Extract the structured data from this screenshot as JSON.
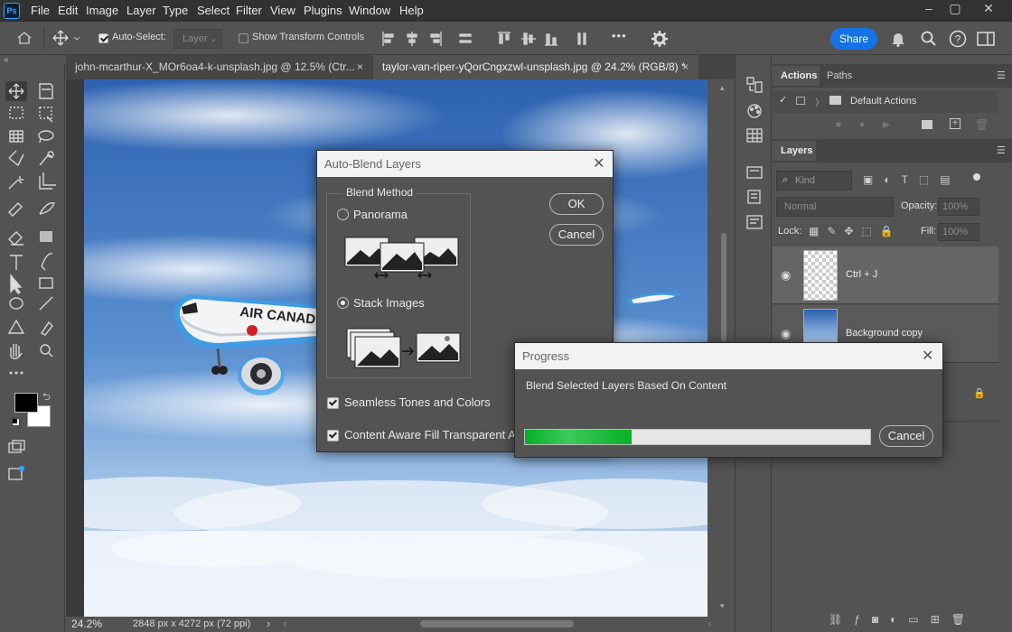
{
  "app": {
    "logo": "Ps"
  },
  "menu": [
    "File",
    "Edit",
    "Image",
    "Layer",
    "Type",
    "Select",
    "Filter",
    "View",
    "Plugins",
    "Window",
    "Help"
  ],
  "options": {
    "auto_select_label": "Auto-Select:",
    "auto_select_target": "Layer",
    "show_transform_label": "Show Transform Controls",
    "share_label": "Share",
    "more": "•••"
  },
  "tabs": [
    {
      "label": "john-mcarthur-X_MOr6oa4-k-unsplash.jpg @ 12.5% (Ctr...",
      "active": false
    },
    {
      "label": "taylor-van-riper-yQorCngxzwl-unsplash.jpg @ 24.2% (RGB/8) *",
      "active": true
    }
  ],
  "close_glyph": "×",
  "status": {
    "zoom": "24.2%",
    "dimensions": "2848 px x 4272 px (72 ppi)",
    "arrow": "›",
    "left": "‹"
  },
  "actions_panel": {
    "tabs": [
      "Actions",
      "Paths"
    ],
    "set_name": "Default Actions"
  },
  "layers_panel": {
    "title": "Layers",
    "kind_placeholder": "Kind",
    "blend_mode": "Normal",
    "opacity_label": "Opacity:",
    "opacity_value": "100%",
    "lock_label": "Lock:",
    "fill_label": "Fill:",
    "fill_value": "100%",
    "layers": [
      {
        "name": "Ctrl + J"
      },
      {
        "name": "Background copy"
      }
    ]
  },
  "auto_blend": {
    "title": "Auto-Blend Layers",
    "group_label": "Blend Method",
    "panorama": "Panorama",
    "stack": "Stack Images",
    "selected_method": "Stack Images",
    "seamless": "Seamless Tones and Colors",
    "content_aware": "Content Aware Fill Transparent Areas",
    "ok": "OK",
    "cancel": "Cancel"
  },
  "progress": {
    "title": "Progress",
    "message": "Blend Selected Layers Based On Content",
    "cancel": "Cancel",
    "fraction": 0.31
  },
  "colors": {
    "accent": "#1473e6",
    "progress_fill": "#2bb431",
    "dark": "#323232",
    "panel": "#535353"
  }
}
